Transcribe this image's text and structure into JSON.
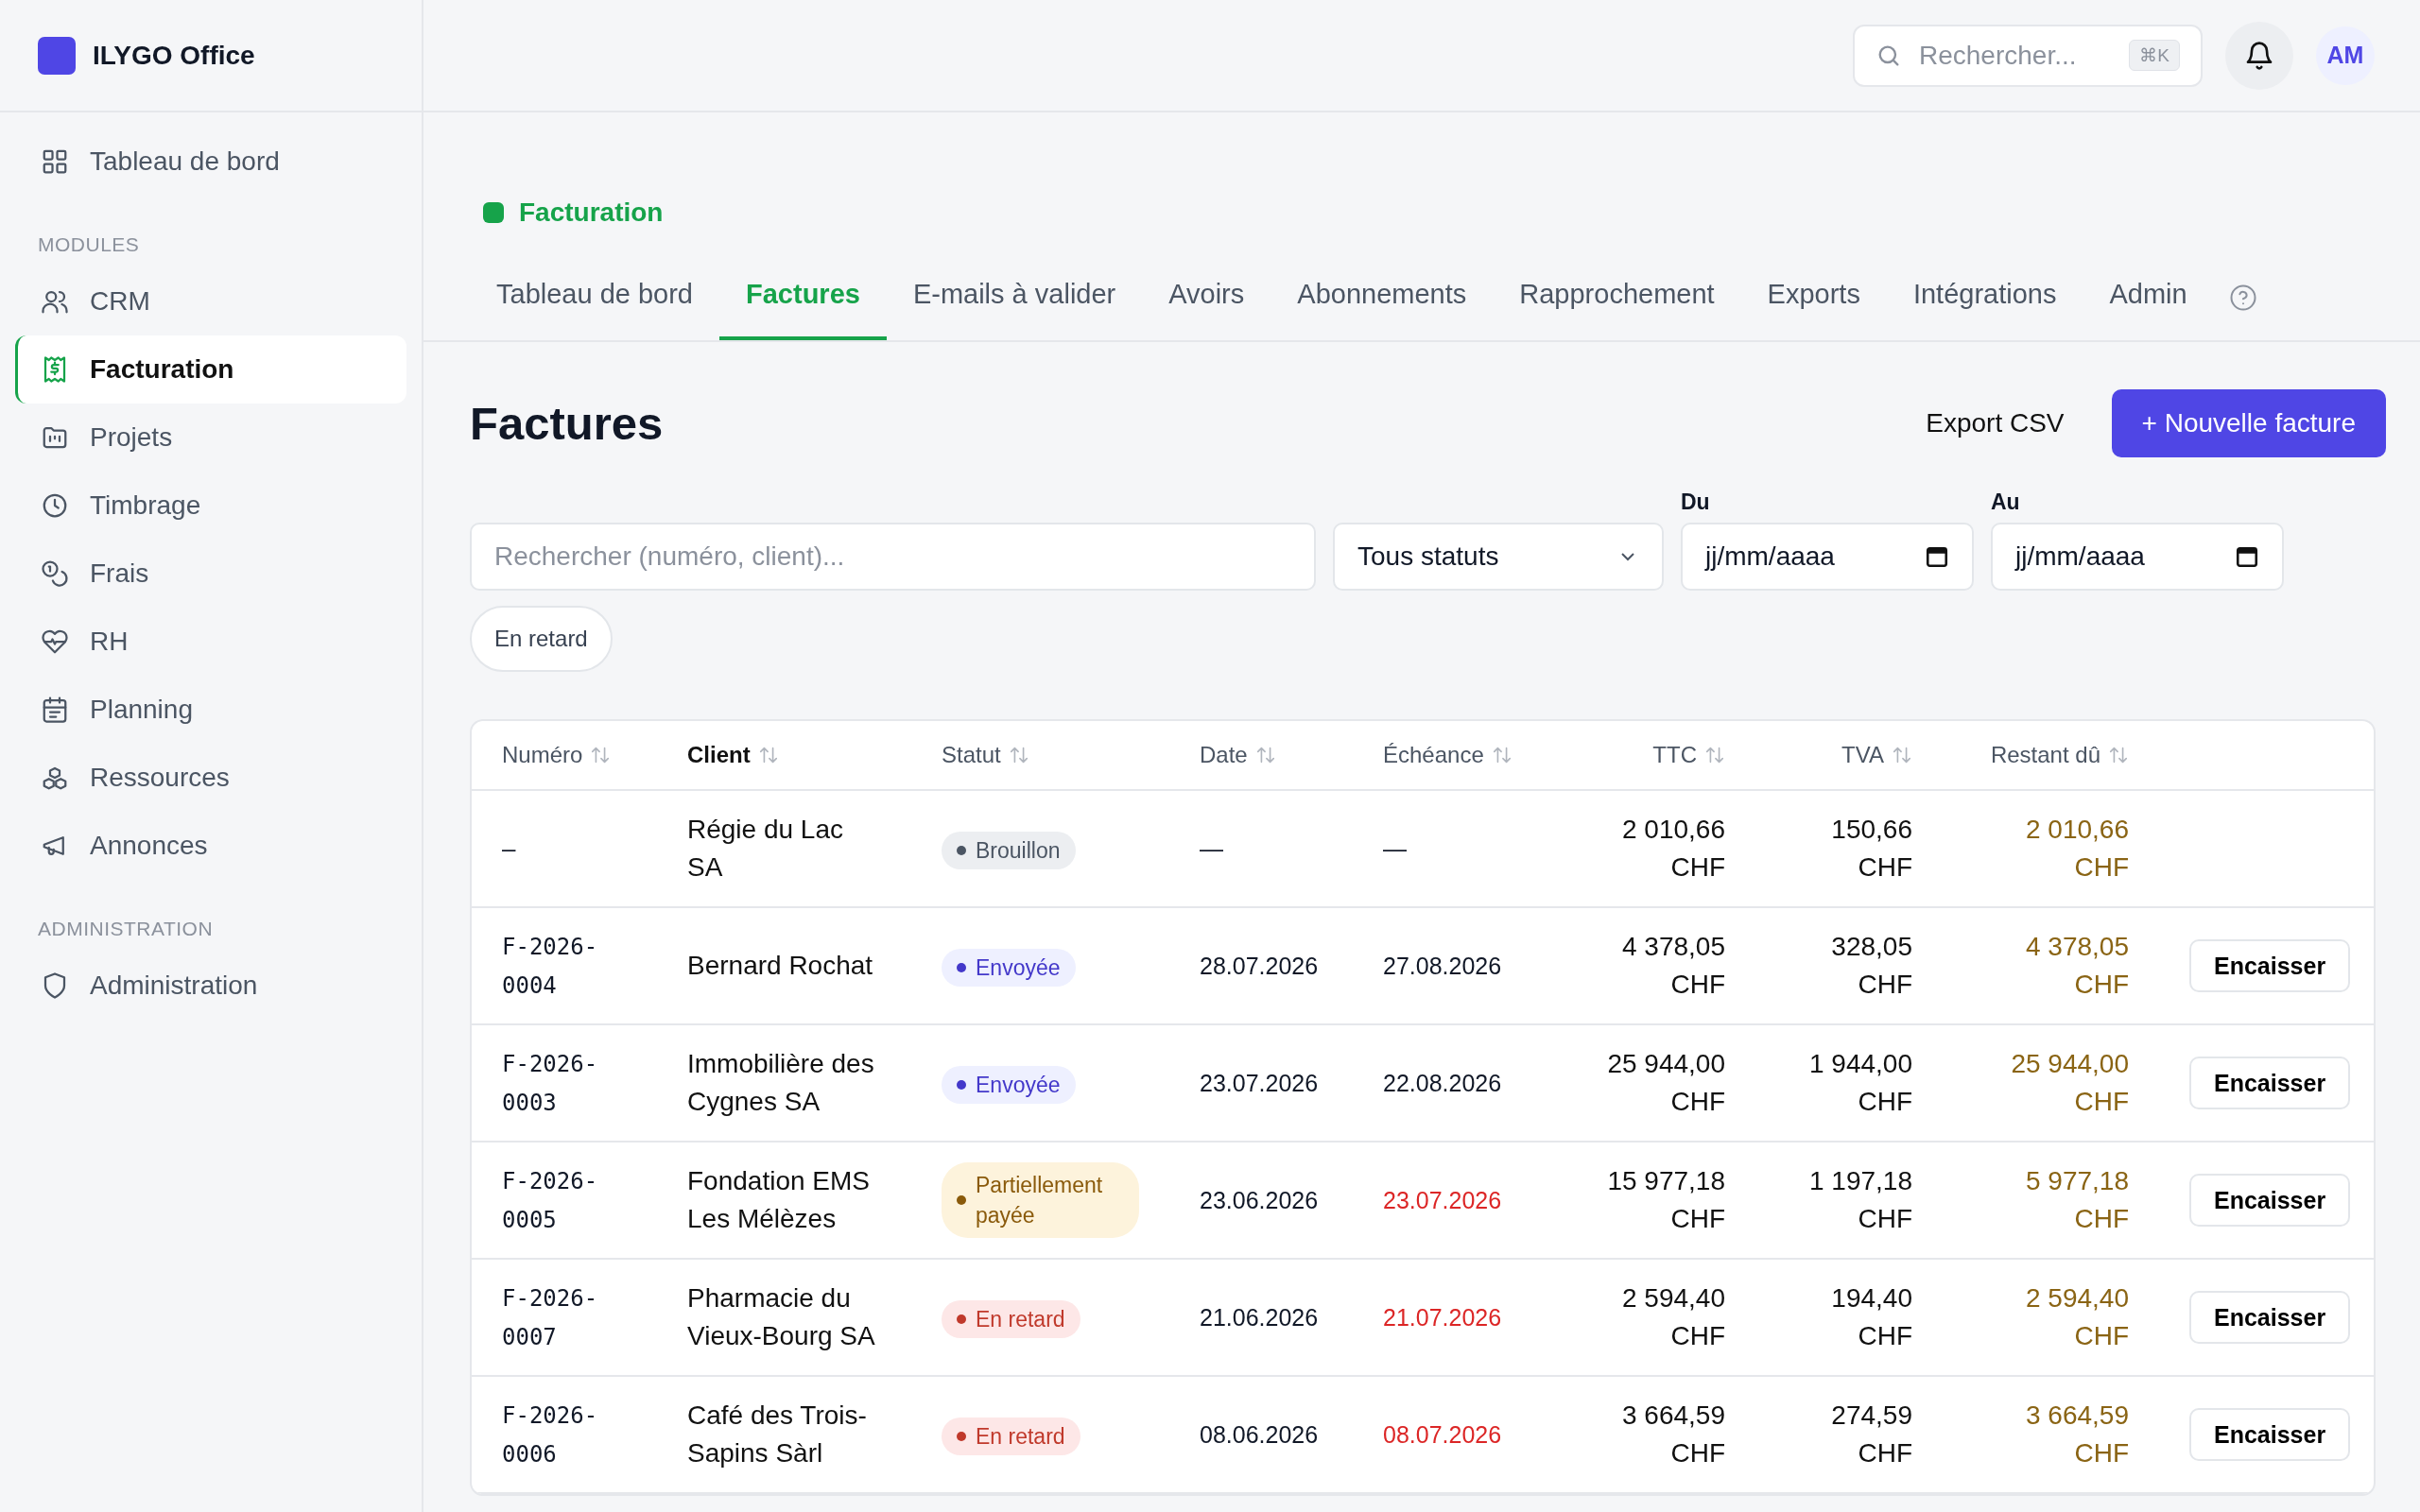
{
  "app": {
    "name": "ILYGO Office"
  },
  "sidebar": {
    "sections": [
      {
        "items": [
          {
            "label": "Tableau de bord",
            "selected": false
          }
        ]
      },
      {
        "title": "MODULES",
        "items": [
          {
            "label": "CRM",
            "selected": false
          },
          {
            "label": "Facturation",
            "selected": true
          },
          {
            "label": "Projets",
            "selected": false
          },
          {
            "label": "Timbrage",
            "selected": false
          },
          {
            "label": "Frais",
            "selected": false
          },
          {
            "label": "RH",
            "selected": false
          },
          {
            "label": "Planning",
            "selected": false
          },
          {
            "label": "Ressources",
            "selected": false
          },
          {
            "label": "Annonces",
            "selected": false
          }
        ]
      },
      {
        "title": "ADMINISTRATION",
        "items": [
          {
            "label": "Administration",
            "selected": false
          }
        ]
      }
    ]
  },
  "topbar": {
    "search": {
      "placeholder": "Rechercher...",
      "shortcut": "⌘K"
    },
    "avatar": "AM"
  },
  "module": {
    "title": "Facturation"
  },
  "tabs": [
    {
      "label": "Tableau de bord",
      "selected": false
    },
    {
      "label": "Factures",
      "selected": true
    },
    {
      "label": "E-mails à valider",
      "selected": false
    },
    {
      "label": "Avoirs",
      "selected": false
    },
    {
      "label": "Abonnements",
      "selected": false
    },
    {
      "label": "Rapprochement",
      "selected": false
    },
    {
      "label": "Exports",
      "selected": false
    },
    {
      "label": "Intégrations",
      "selected": false
    },
    {
      "label": "Admin",
      "selected": false
    }
  ],
  "page": {
    "title": "Factures",
    "export_button": "Export CSV",
    "new_button": "+ Nouvelle facture"
  },
  "filters": {
    "search": {
      "placeholder": "Rechercher (numéro, client)..."
    },
    "status": "Tous statuts",
    "from": {
      "label": "Du",
      "value": "jj/mm/aaaa"
    },
    "to": {
      "label": "Au",
      "value": "jj/mm/aaaa"
    },
    "overdue_chip": "En retard"
  },
  "table": {
    "columns": [
      {
        "label": "Numéro",
        "selected": false
      },
      {
        "label": "Client",
        "selected": true
      },
      {
        "label": "Statut",
        "selected": false
      },
      {
        "label": "Date",
        "selected": false
      },
      {
        "label": "Échéance",
        "selected": false
      },
      {
        "label": "TTC",
        "selected": false
      },
      {
        "label": "TVA",
        "selected": false
      },
      {
        "label": "Restant dû",
        "selected": false
      }
    ],
    "rows": [
      {
        "number": "—",
        "client": "Régie du Lac SA",
        "status": {
          "kind": "draft",
          "label": "Brouillon"
        },
        "date": "—",
        "due": "—",
        "overdue": false,
        "ttc": "2 010,66 CHF",
        "tva": "150,66 CHF",
        "remaining": "2 010,66 CHF"
      },
      {
        "number": "F-2026-0004",
        "client": "Bernard Rochat",
        "status": {
          "kind": "sent",
          "label": "Envoyée"
        },
        "date": "28.07.2026",
        "due": "27.08.2026",
        "overdue": false,
        "ttc": "4 378,05 CHF",
        "tva": "328,05 CHF",
        "remaining": "4 378,05 CHF",
        "action": "Encaisser"
      },
      {
        "number": "F-2026-0003",
        "client": "Immobilière des Cygnes SA",
        "status": {
          "kind": "sent",
          "label": "Envoyée"
        },
        "date": "23.07.2026",
        "due": "22.08.2026",
        "overdue": false,
        "ttc": "25 944,00 CHF",
        "tva": "1 944,00 CHF",
        "remaining": "25 944,00 CHF",
        "action": "Encaisser"
      },
      {
        "number": "F-2026-0005",
        "client": "Fondation EMS Les Mélèzes",
        "status": {
          "kind": "partial",
          "label": "Partiellement payée"
        },
        "date": "23.06.2026",
        "due": "23.07.2026",
        "overdue": true,
        "ttc": "15 977,18 CHF",
        "tva": "1 197,18 CHF",
        "remaining": "5 977,18 CHF",
        "action": "Encaisser"
      },
      {
        "number": "F-2026-0007",
        "client": "Pharmacie du Vieux-Bourg SA",
        "status": {
          "kind": "overdue",
          "label": "En retard"
        },
        "date": "21.06.2026",
        "due": "21.07.2026",
        "overdue": true,
        "ttc": "2 594,40 CHF",
        "tva": "194,40 CHF",
        "remaining": "2 594,40 CHF",
        "action": "Encaisser"
      },
      {
        "number": "F-2026-0006",
        "client": "Café des Trois-Sapins Sàrl",
        "status": {
          "kind": "overdue",
          "label": "En retard"
        },
        "date": "08.06.2026",
        "due": "08.07.2026",
        "overdue": true,
        "ttc": "3 664,59 CHF",
        "tva": "274,59 CHF",
        "remaining": "3 664,59 CHF",
        "action": "Encaisser"
      }
    ]
  }
}
